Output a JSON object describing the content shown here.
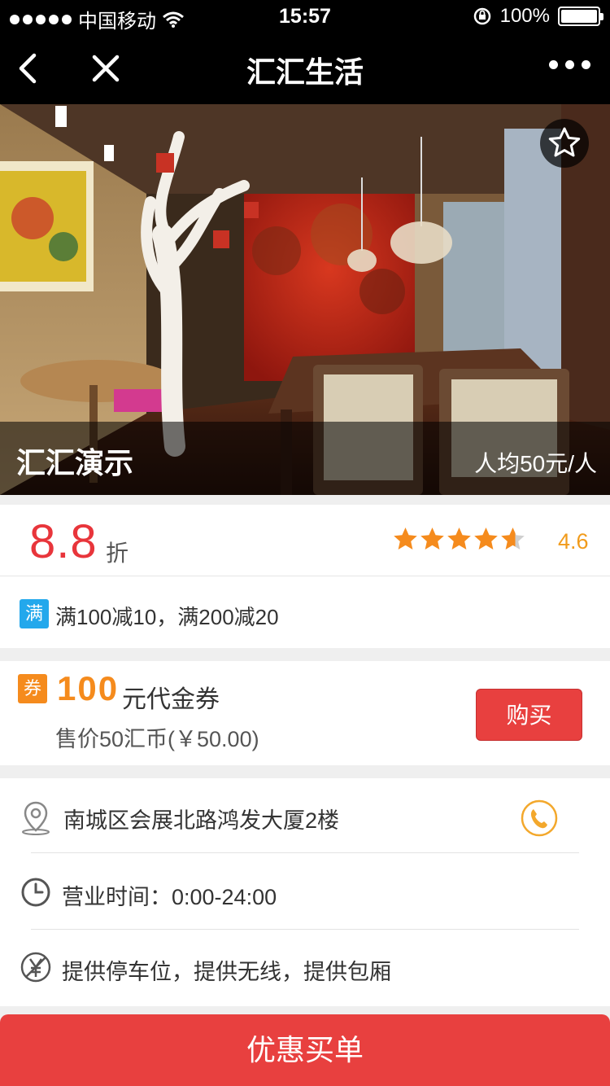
{
  "status_bar": {
    "carrier": "中国移动",
    "time": "15:57",
    "battery": "100%",
    "battery_level": 1.0
  },
  "nav": {
    "title": "汇汇生活"
  },
  "hero": {
    "store_name": "汇汇演示",
    "avg_price": "人均50元/人"
  },
  "discount": {
    "value": "8.8",
    "unit": "折",
    "rating": 4.6,
    "rating_text": "4.6",
    "max_stars": 5
  },
  "promo": {
    "tag": "满",
    "text": "满100减10，满200减20"
  },
  "coupon": {
    "tag": "券",
    "amount": "100",
    "desc": "元代金券",
    "price": "售价50汇币(￥50.00)",
    "buy_label": "购买"
  },
  "info": {
    "address": "南城区会展北路鸿发大厦2楼",
    "hours": "营业时间：0:00-24:00",
    "facilities": "提供停车位，提供无线，提供包厢"
  },
  "footer": {
    "pay_label": "优惠买单"
  },
  "colors": {
    "accent_red": "#e8403f",
    "price_red": "#e8353b",
    "star_orange": "#f19b1b",
    "coupon_orange": "#f58b1d",
    "promo_blue": "#23a8ec"
  }
}
